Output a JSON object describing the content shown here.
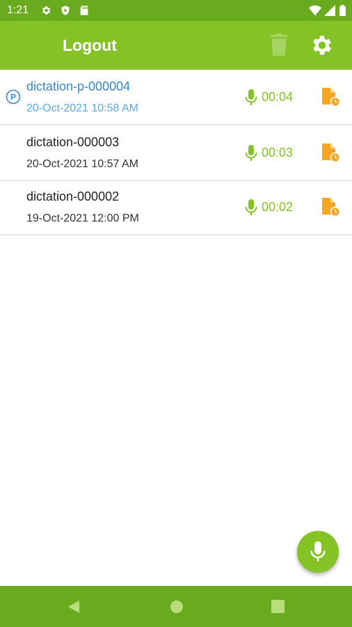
{
  "status_bar": {
    "time": "1:21",
    "left_icons": [
      "gear-icon",
      "shield-play-icon",
      "sd-card-icon"
    ],
    "right_icons": [
      "wifi-icon",
      "signal-icon",
      "battery-icon"
    ]
  },
  "app_bar": {
    "logout_label": "Logout",
    "trash_icon": "trash-icon",
    "settings_icon": "gear-icon"
  },
  "dictations": [
    {
      "name": "dictation-p-000004",
      "date": "20-Oct-2021 10:58 AM",
      "duration": "00:04",
      "badge": "P",
      "highlighted": true
    },
    {
      "name": "dictation-000003",
      "date": "20-Oct-2021 10:57 AM",
      "duration": "00:03",
      "highlighted": false
    },
    {
      "name": "dictation-000002",
      "date": "19-Oct-2021 12:00 PM",
      "duration": "00:02",
      "highlighted": false
    }
  ],
  "fab": {
    "icon": "microphone-icon"
  },
  "nav_bar": {
    "icons": [
      "back-icon",
      "home-icon",
      "recents-icon"
    ]
  },
  "colors": {
    "status_bar": "#6aaa1e",
    "app_bar": "#84c226",
    "accent_green": "#84c226",
    "highlight_blue": "#3a86c8",
    "file_orange": "#f5a623"
  }
}
